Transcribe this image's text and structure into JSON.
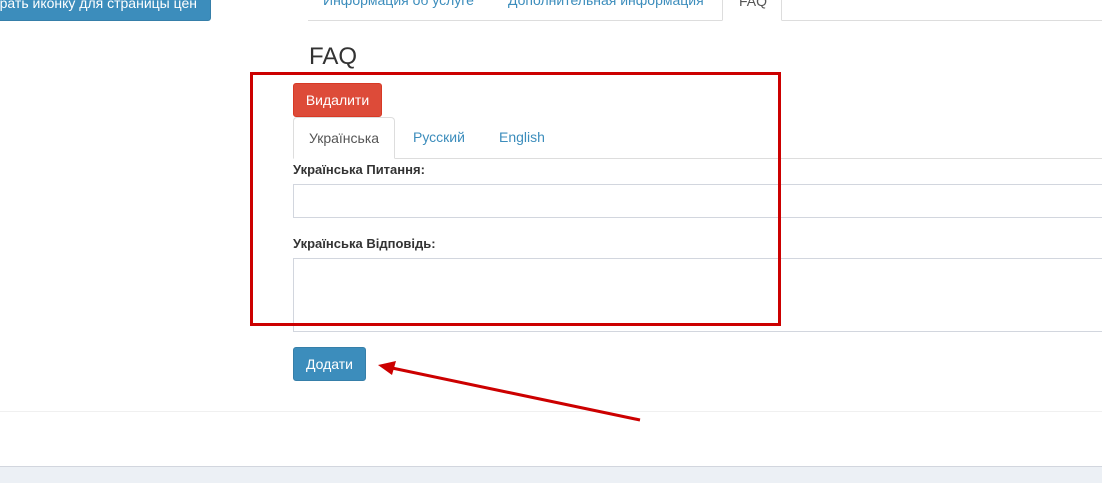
{
  "header": {
    "pricing_icon_button": "рать иконку для страницы цен"
  },
  "main_tabs": [
    {
      "label": "Информация об услуге"
    },
    {
      "label": "Дополнительная информация"
    },
    {
      "label": "FAQ"
    }
  ],
  "faq": {
    "title": "FAQ",
    "delete_button": "Видалити",
    "language_tabs": [
      {
        "label": "Українська",
        "active": true
      },
      {
        "label": "Русский",
        "active": false
      },
      {
        "label": "English",
        "active": false
      }
    ],
    "question_label": "Українська Питання:",
    "question_value": "",
    "answer_label": "Українська Відповідь:",
    "answer_value": "",
    "add_button": "Додати"
  },
  "annotation": {
    "color": "#cc0000"
  },
  "colors": {
    "primary": "#3c8dbc",
    "danger": "#dd4b39",
    "annotation": "#cc0000"
  }
}
